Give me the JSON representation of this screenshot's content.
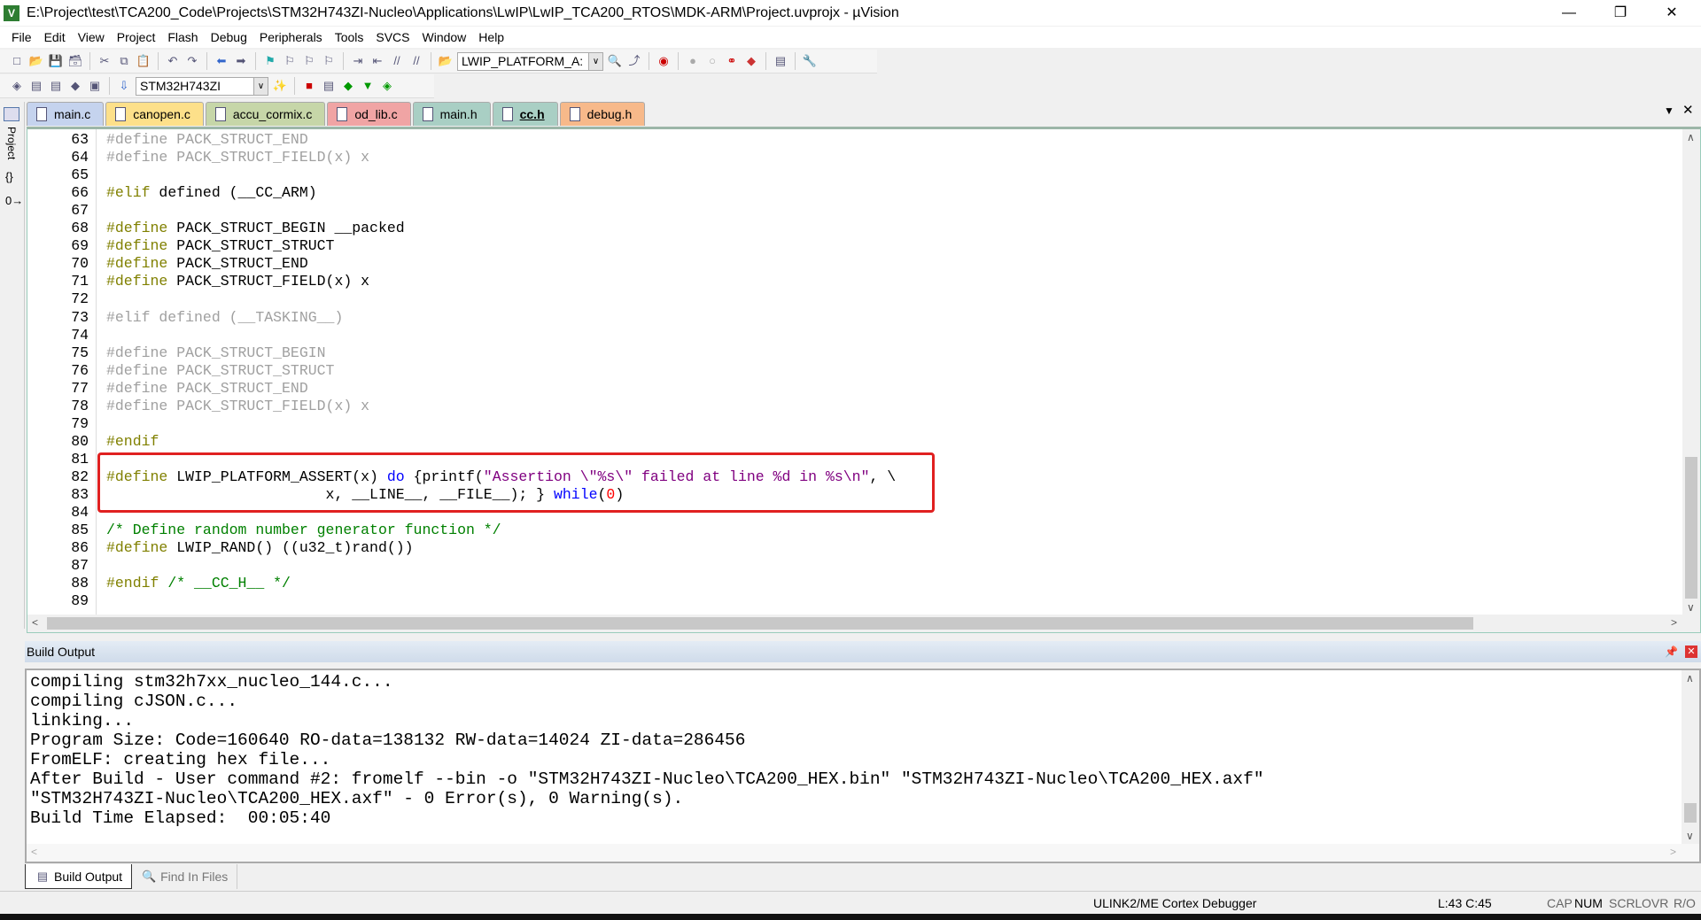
{
  "window": {
    "title": "E:\\Project\\test\\TCA200_Code\\Projects\\STM32H743ZI-Nucleo\\Applications\\LwIP\\LwIP_TCA200_RTOS\\MDK-ARM\\Project.uvprojx - µVision",
    "logo": "V"
  },
  "menu": [
    "File",
    "Edit",
    "View",
    "Project",
    "Flash",
    "Debug",
    "Peripherals",
    "Tools",
    "SVCS",
    "Window",
    "Help"
  ],
  "toolbar": {
    "find_value": "LWIP_PLATFORM_A:",
    "target_value": "STM32H743ZI"
  },
  "left_strip": {
    "project_label": "Project"
  },
  "tabs": [
    {
      "label": "main.c",
      "color": "#c5d3ee"
    },
    {
      "label": "canopen.c",
      "color": "#fde08a"
    },
    {
      "label": "accu_cormix.c",
      "color": "#c6d6a8"
    },
    {
      "label": "od_lib.c",
      "color": "#f0a4a4"
    },
    {
      "label": "main.h",
      "color": "#a9cfc4"
    },
    {
      "label": "cc.h",
      "color": "#a9cfc4",
      "active": true
    },
    {
      "label": "debug.h",
      "color": "#f7b98a"
    }
  ],
  "editor": {
    "lines": [
      {
        "n": "63",
        "t": [
          [
            "#define PACK_STRUCT_END",
            "in"
          ]
        ]
      },
      {
        "n": "64",
        "t": [
          [
            "#define PACK_STRUCT_FIELD(x) x",
            "in"
          ]
        ]
      },
      {
        "n": "65",
        "t": []
      },
      {
        "n": "66",
        "t": [
          [
            "#elif ",
            "pp"
          ],
          [
            "defined (__CC_ARM)",
            "id"
          ]
        ]
      },
      {
        "n": "67",
        "t": []
      },
      {
        "n": "68",
        "t": [
          [
            "#define ",
            "pp"
          ],
          [
            "PACK_STRUCT_BEGIN __packed",
            "id"
          ]
        ]
      },
      {
        "n": "69",
        "t": [
          [
            "#define ",
            "pp"
          ],
          [
            "PACK_STRUCT_STRUCT",
            "id"
          ]
        ]
      },
      {
        "n": "70",
        "t": [
          [
            "#define ",
            "pp"
          ],
          [
            "PACK_STRUCT_END",
            "id"
          ]
        ]
      },
      {
        "n": "71",
        "t": [
          [
            "#define ",
            "pp"
          ],
          [
            "PACK_STRUCT_FIELD(x) x",
            "id"
          ]
        ]
      },
      {
        "n": "72",
        "t": []
      },
      {
        "n": "73",
        "t": [
          [
            "#elif defined (__TASKING__)",
            "in"
          ]
        ]
      },
      {
        "n": "74",
        "t": []
      },
      {
        "n": "75",
        "t": [
          [
            "#define PACK_STRUCT_BEGIN",
            "in"
          ]
        ]
      },
      {
        "n": "76",
        "t": [
          [
            "#define PACK_STRUCT_STRUCT",
            "in"
          ]
        ]
      },
      {
        "n": "77",
        "t": [
          [
            "#define PACK_STRUCT_END",
            "in"
          ]
        ]
      },
      {
        "n": "78",
        "t": [
          [
            "#define PACK_STRUCT_FIELD(x) x",
            "in"
          ]
        ]
      },
      {
        "n": "79",
        "t": []
      },
      {
        "n": "80",
        "t": [
          [
            "#endif",
            "pp"
          ]
        ]
      },
      {
        "n": "81",
        "t": []
      },
      {
        "n": "82",
        "t": [
          [
            "#define ",
            "pp"
          ],
          [
            "LWIP_PLATFORM_ASSERT(x) ",
            "id"
          ],
          [
            "do",
            "kw"
          ],
          [
            " {printf(",
            "id"
          ],
          [
            "\"Assertion \\\"%s\\\" failed at line %d in %s\\n\"",
            "str"
          ],
          [
            ", \\",
            "id"
          ]
        ]
      },
      {
        "n": "83",
        "t": [
          [
            "                         x, __LINE__, __FILE__); } ",
            "id"
          ],
          [
            "while",
            "kw"
          ],
          [
            "(",
            "id"
          ],
          [
            "0",
            "num"
          ],
          [
            ")",
            "id"
          ]
        ]
      },
      {
        "n": "84",
        "t": []
      },
      {
        "n": "85",
        "t": [
          [
            "/* Define random number generator function */",
            "cm"
          ]
        ]
      },
      {
        "n": "86",
        "t": [
          [
            "#define ",
            "pp"
          ],
          [
            "LWIP_RAND() ((u32_t)rand())",
            "id"
          ]
        ]
      },
      {
        "n": "87",
        "t": []
      },
      {
        "n": "88",
        "t": [
          [
            "#endif ",
            "pp"
          ],
          [
            "/* __CC_H__ */",
            "cm"
          ]
        ]
      },
      {
        "n": "89",
        "t": []
      }
    ]
  },
  "build_output": {
    "title": "Build Output",
    "lines": [
      "compiling stm32h7xx_nucleo_144.c...",
      "compiling cJSON.c...",
      "linking...",
      "Program Size: Code=160640 RO-data=138132 RW-data=14024 ZI-data=286456",
      "FromELF: creating hex file...",
      "After Build - User command #2: fromelf --bin -o \"STM32H743ZI-Nucleo\\TCA200_HEX.bin\" \"STM32H743ZI-Nucleo\\TCA200_HEX.axf\"",
      "\"STM32H743ZI-Nucleo\\TCA200_HEX.axf\" - 0 Error(s), 0 Warning(s).",
      "Build Time Elapsed:  00:05:40"
    ]
  },
  "bottom_tabs": [
    "Build Output",
    "Find In Files"
  ],
  "status": {
    "debugger": "ULINK2/ME Cortex Debugger",
    "position": "L:43 C:45",
    "cap": "CAP",
    "num": "NUM",
    "scrl": "SCRL",
    "ovr": "OVR",
    "ro": "R/O"
  }
}
